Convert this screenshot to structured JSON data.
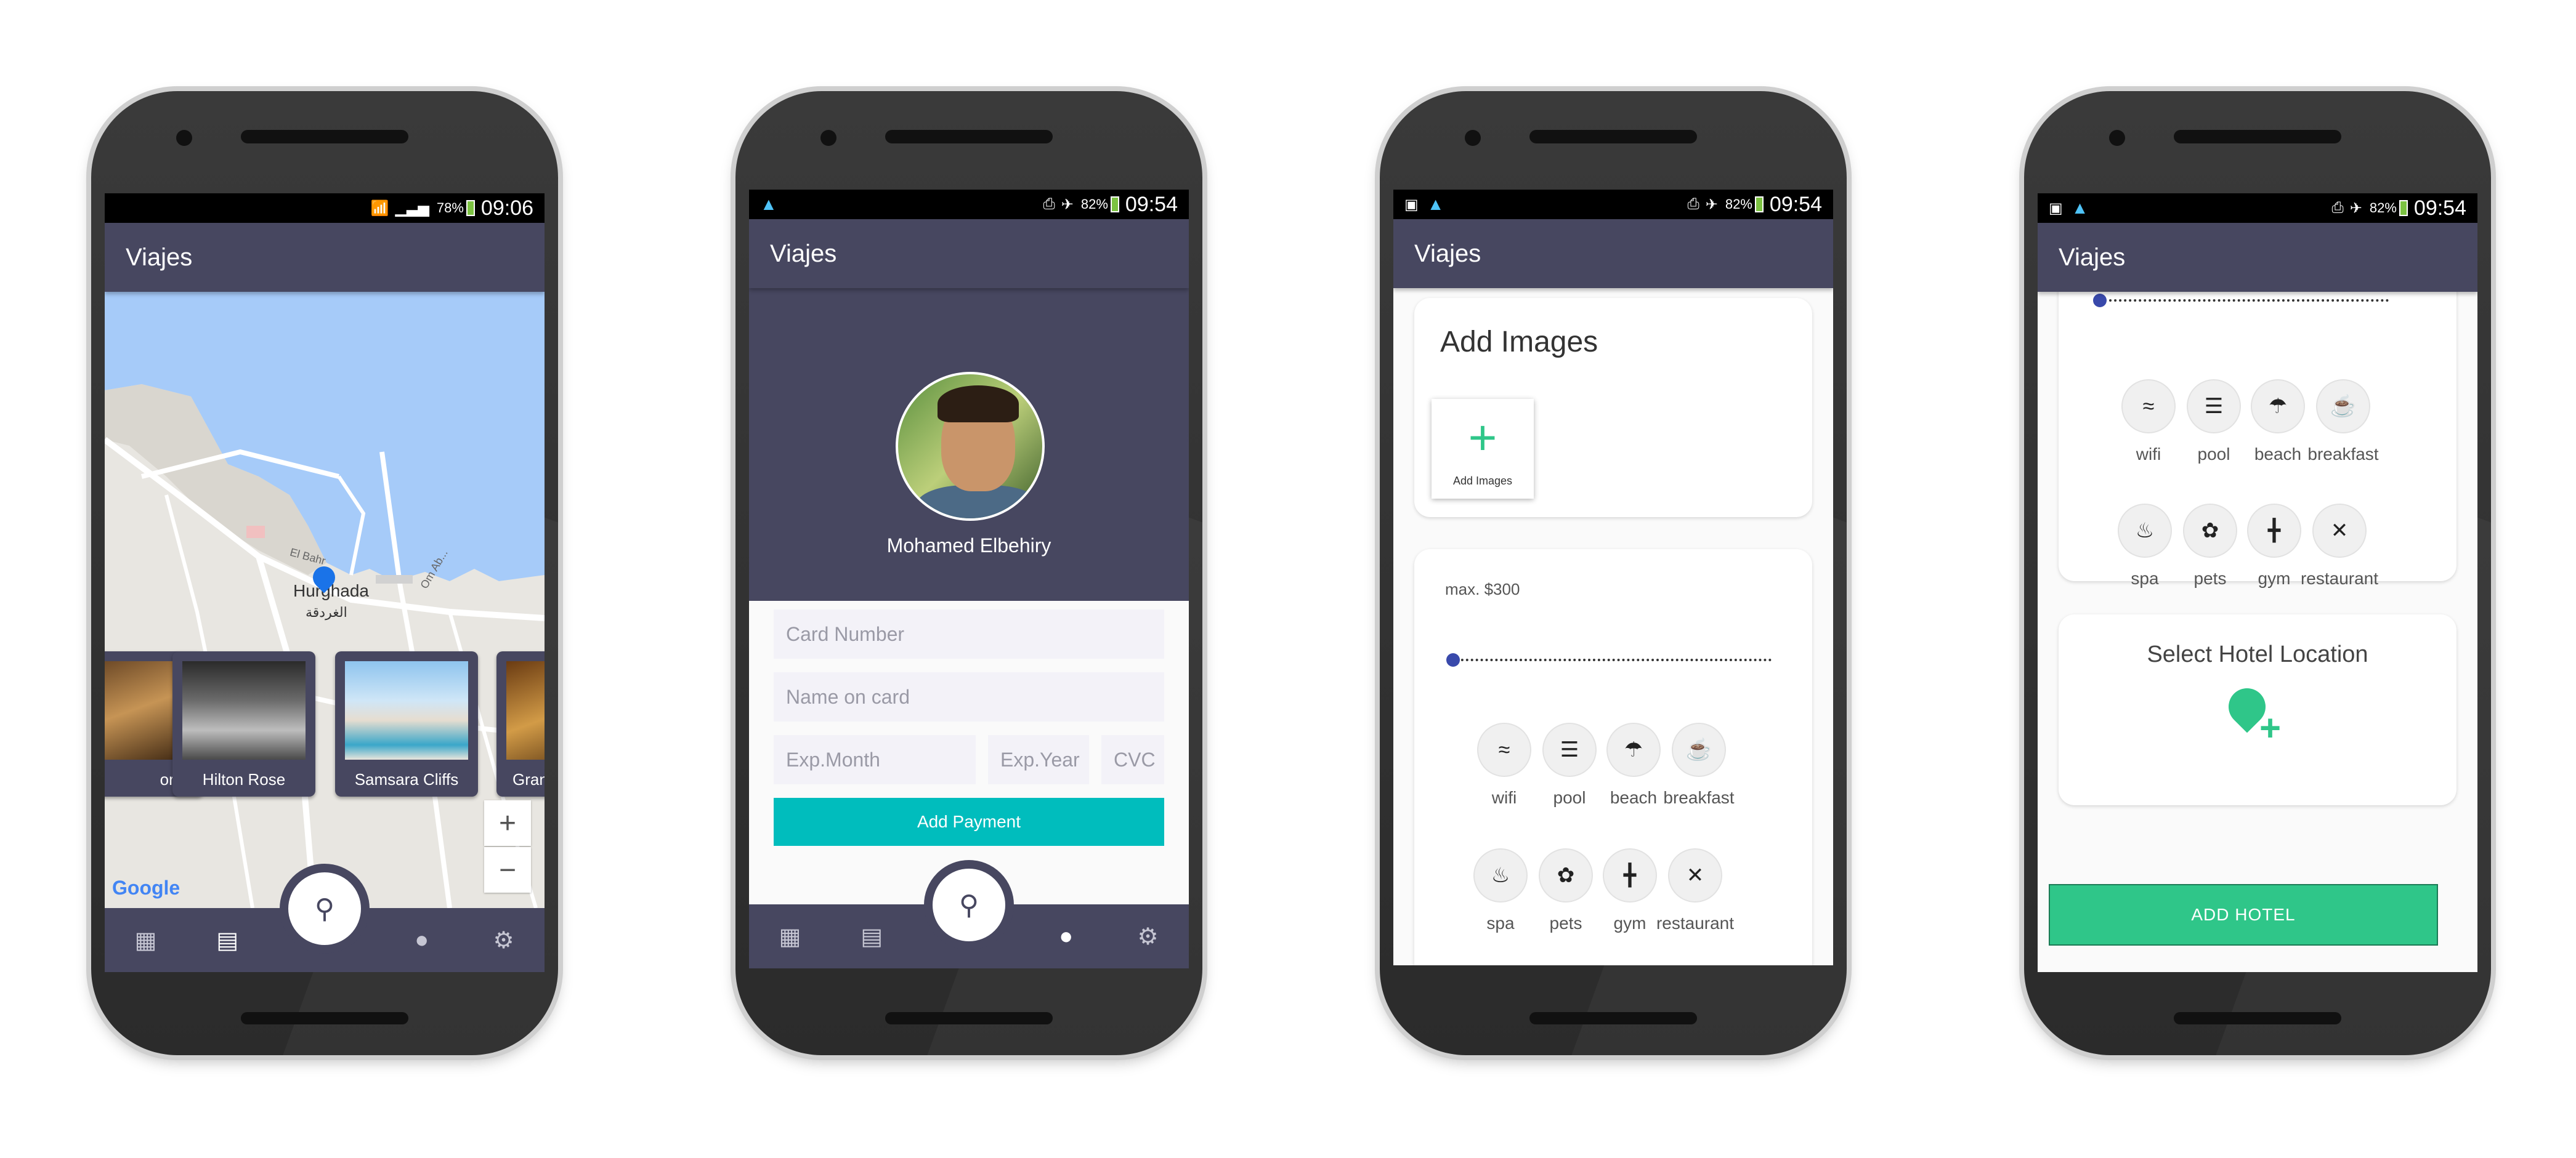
{
  "phones": [
    {
      "status": {
        "time": "09:06",
        "battery": "78%"
      },
      "app_title": "Viajes",
      "map": {
        "city_label": "Hurghada",
        "city_label_ar": "الغردقة",
        "street_labels": [
          "El Bahr",
          "Om Ab..."
        ],
        "google_label": "Google",
        "zoom_in": "+",
        "zoom_out": "−",
        "hotels": [
          "ort",
          "Hilton Rose",
          "Samsara Cliffs",
          "Gran"
        ]
      },
      "nav": [
        "grid",
        "map",
        "search",
        "person",
        "settings"
      ]
    },
    {
      "status": {
        "time": "09:54",
        "battery": "82%"
      },
      "app_title": "Viajes",
      "profile": {
        "name": "Mohamed Elbehiry",
        "card_number_placeholder": "Card Number",
        "name_on_card_placeholder": "Name on card",
        "exp_month_placeholder": "Exp.Month",
        "exp_year_placeholder": "Exp.Year",
        "cvc_placeholder": "CVC",
        "add_payment": "Add Payment"
      },
      "nav": [
        "grid",
        "map",
        "search",
        "person",
        "settings"
      ]
    },
    {
      "status": {
        "time": "09:54",
        "battery": "82%"
      },
      "app_title": "Viajes",
      "add_images": {
        "title": "Add Images",
        "tile_label": "Add Images"
      },
      "filter": {
        "max_label": "max. $300",
        "max_value": 300,
        "slider_fraction": 0.0
      },
      "amenities": [
        "wifi",
        "pool",
        "beach",
        "breakfast",
        "spa",
        "pets",
        "gym",
        "restaurant"
      ]
    },
    {
      "status": {
        "time": "09:54",
        "battery": "82%"
      },
      "app_title": "Viajes",
      "amenities": [
        "wifi",
        "pool",
        "beach",
        "breakfast",
        "spa",
        "pets",
        "gym",
        "restaurant"
      ],
      "location": {
        "title": "Select Hotel Location"
      },
      "add_hotel": "ADD HOTEL"
    }
  ]
}
